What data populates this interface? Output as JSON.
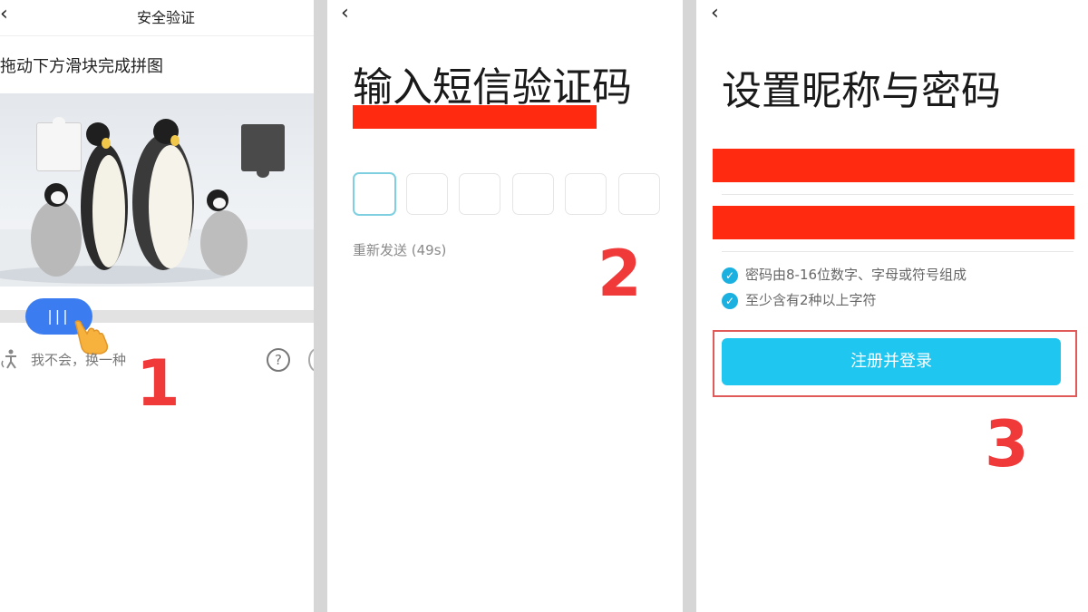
{
  "panel1": {
    "title": "安全验证",
    "back_icon": "‹",
    "instruction": "拖动下方滑块完成拼图",
    "slider_handle": "|||",
    "switch_method": "我不会，换一种",
    "help_icon": "?",
    "step_number": "1"
  },
  "panel2": {
    "back_icon": "‹",
    "title": "输入短信验证码",
    "code_boxes": 6,
    "resend": "重新发送 (49s)",
    "step_number": "2"
  },
  "panel3": {
    "back_icon": "‹",
    "title": "设置昵称与密码",
    "rules": [
      "密码由8-16位数字、字母或符号组成",
      "至少含有2种以上字符"
    ],
    "register_button": "注册并登录",
    "step_number": "3"
  },
  "colors": {
    "accent_blue": "#3b7cf0",
    "button_cyan": "#1fc6f0",
    "step_red": "#f03a3a",
    "redaction": "#ff2a0f",
    "outline_red": "#e05a5a"
  }
}
